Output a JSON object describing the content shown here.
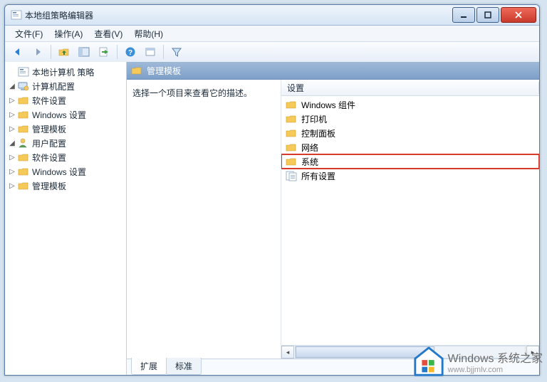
{
  "window": {
    "title": "本地组策略编辑器"
  },
  "menu": {
    "file": "文件(F)",
    "action": "操作(A)",
    "view": "查看(V)",
    "help": "帮助(H)"
  },
  "tree": {
    "root": "本地计算机 策略",
    "computer": "计算机配置",
    "user": "用户配置",
    "software": "软件设置",
    "windows": "Windows 设置",
    "admin": "管理模板"
  },
  "pathbar": {
    "label": "管理模板"
  },
  "desc": {
    "hint": "选择一个项目来查看它的描述。"
  },
  "list": {
    "header": "设置",
    "items": [
      {
        "label": "Windows 组件",
        "kind": "folder"
      },
      {
        "label": "打印机",
        "kind": "folder"
      },
      {
        "label": "控制面板",
        "kind": "folder"
      },
      {
        "label": "网络",
        "kind": "folder"
      },
      {
        "label": "系统",
        "kind": "folder",
        "highlight": true
      },
      {
        "label": "所有设置",
        "kind": "settings"
      }
    ]
  },
  "tabs": {
    "extended": "扩展",
    "standard": "标准"
  },
  "watermark": {
    "brand": "Windows",
    "suffix": " 系统之家",
    "url": "www.bjjmlv.com"
  }
}
